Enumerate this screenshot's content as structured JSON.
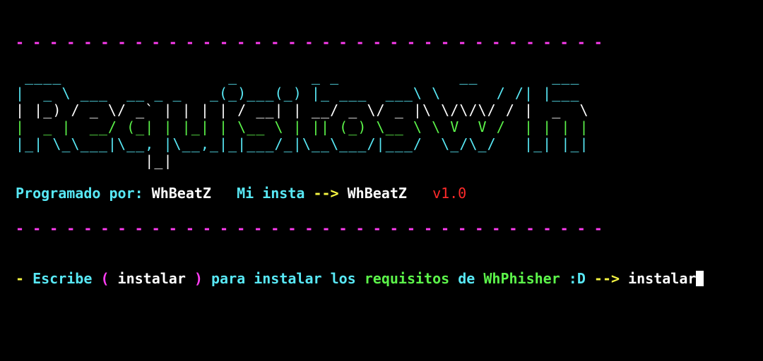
{
  "separator_top": "- - - - - - - - - - - - - - - - - - - - - - - - - - - - - - - - - - -",
  "separator_bottom": "- - - - - - - - - - - - - - - - - - - - - - - - - - - - - - - - - - -",
  "banner": {
    "lines": [
      " ____                  _        _ _             __        ___",
      "|  _ \\ ___  __ _ _   _(_)___(_) |_ ___  ___\\ \\      / /| |___",
      "| |_) / _ \\/ _` | | | | / __| | __/ _ \\/ _ |\\ \\/\\/\\/ / |  _  \\",
      "|  _ |  __/ (_| | |_| | \\__ \\ | || (_) \\__ \\ \\ V  V /  | | | |",
      "|_| \\_\\___|\\__, |\\__,_|_|___/_|\\__\\___/|___/  \\_/\\_/   |_| |_|",
      "              |_|"
    ],
    "colors": [
      "#58e8f5",
      "#58e8f5",
      "#ffffff",
      "#5cf44a",
      "#58e8f5",
      "#ffffff"
    ]
  },
  "credits": {
    "label_programmed": "Programado por:",
    "author": "WhBeatZ",
    "label_insta": "Mi insta",
    "arrow": "-->",
    "insta_handle": "WhBeatZ",
    "version": "v1.0"
  },
  "prompt": {
    "bullet": "-",
    "word_escribe": "Escribe",
    "paren_open": "(",
    "keyword": "instalar",
    "paren_close": ")",
    "text_para": "para instalar los",
    "word_requisitos": "requisitos",
    "word_de": "de",
    "app_name": "WhPhisher",
    "smiley": ":D",
    "arrow": "-->",
    "input_value": "instalar"
  },
  "colors": {
    "background": "#000000",
    "cyan": "#58e8f5",
    "green": "#5cf44a",
    "yellow": "#f5f542",
    "magenta": "#ff3df2",
    "red": "#ff2a2a",
    "white": "#ffffff"
  }
}
